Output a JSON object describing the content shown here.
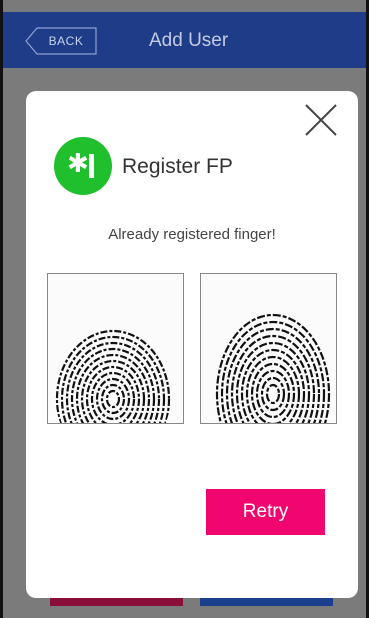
{
  "topbar": {
    "back_label": "BACK",
    "title": "Add User",
    "color": "#1f3c89"
  },
  "dialog": {
    "title": "Register FP",
    "badge_icon": "fingerprint-register-icon",
    "badge_color": "#1fbf2d",
    "close_icon": "close-icon",
    "status_message": "Already registered finger!",
    "images": [
      {
        "name": "fingerprint-scan-1"
      },
      {
        "name": "fingerprint-scan-2"
      }
    ],
    "retry_label": "Retry",
    "retry_color": "#f0066e"
  }
}
